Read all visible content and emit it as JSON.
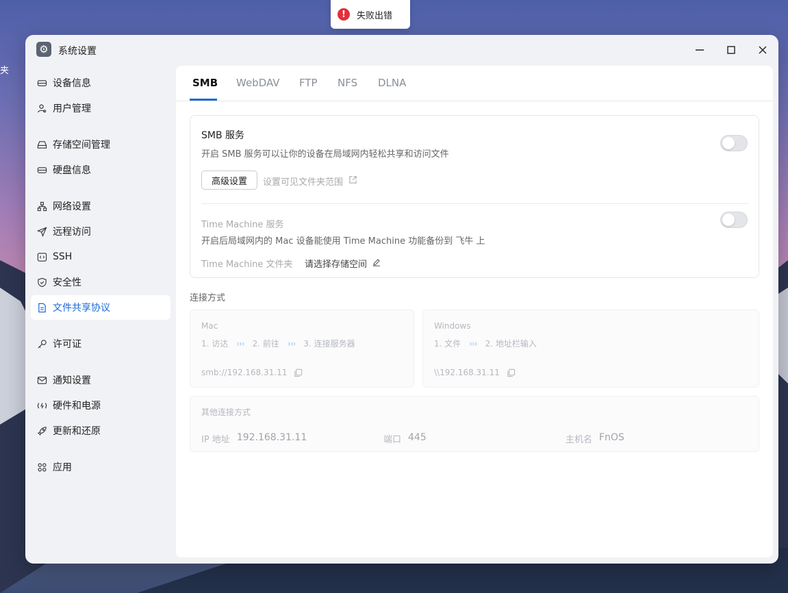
{
  "desktop": {
    "edge_text": "夹"
  },
  "toast": {
    "icon": "error-icon",
    "text": "失败出错"
  },
  "window": {
    "title": "系统设置",
    "icon": "gear-icon",
    "controls": {
      "minimize": "—",
      "maximize": "☐",
      "close": "✕"
    }
  },
  "sidebar": {
    "items": [
      {
        "label": "设备信息",
        "icon": "drive-icon"
      },
      {
        "label": "用户管理",
        "icon": "users-icon"
      },
      {
        "label": "存储空间管理",
        "icon": "storage-icon"
      },
      {
        "label": "硬盘信息",
        "icon": "disk-icon"
      },
      {
        "label": "网络设置",
        "icon": "network-icon"
      },
      {
        "label": "远程访问",
        "icon": "send-icon"
      },
      {
        "label": "SSH",
        "icon": "terminal-icon"
      },
      {
        "label": "安全性",
        "icon": "shield-icon"
      },
      {
        "label": "文件共享协议",
        "icon": "document-icon",
        "active": true
      },
      {
        "label": "许可证",
        "icon": "key-icon"
      },
      {
        "label": "通知设置",
        "icon": "mail-icon"
      },
      {
        "label": "硬件和电源",
        "icon": "power-icon"
      },
      {
        "label": "更新和还原",
        "icon": "rocket-icon"
      },
      {
        "label": "应用",
        "icon": "apps-icon"
      }
    ]
  },
  "tabs": [
    {
      "label": "SMB",
      "active": true
    },
    {
      "label": "WebDAV"
    },
    {
      "label": "FTP"
    },
    {
      "label": "NFS"
    },
    {
      "label": "DLNA"
    }
  ],
  "smb": {
    "title": "SMB 服务",
    "desc": "开启 SMB 服务可以让你的设备在局域网内轻松共享和访问文件",
    "enabled": false,
    "advanced_button": "高级设置",
    "range_link": "设置可见文件夹范围",
    "time_machine": {
      "title": "Time Machine 服务",
      "desc": "开启后局域网内的 Mac 设备能使用 Time Machine 功能备份到 飞牛 上",
      "enabled": false,
      "folder_label": "Time Machine 文件夹",
      "folder_value": "请选择存储空间"
    }
  },
  "connection": {
    "section_label": "连接方式",
    "mac": {
      "os": "Mac",
      "steps": [
        "1. 访达",
        "2. 前往",
        "3. 连接服务器"
      ],
      "arrow": "›››",
      "address": "smb://192.168.31.11"
    },
    "windows": {
      "os": "Windows",
      "steps": [
        "1. 文件",
        "2. 地址栏输入"
      ],
      "arrow": "›››",
      "address": "\\\\192.168.31.11"
    },
    "other": {
      "title": "其他连接方式",
      "ip_label": "IP 地址",
      "ip_value": "192.168.31.11",
      "port_label": "端口",
      "port_value": "445",
      "host_label": "主机名",
      "host_value": "FnOS"
    }
  }
}
